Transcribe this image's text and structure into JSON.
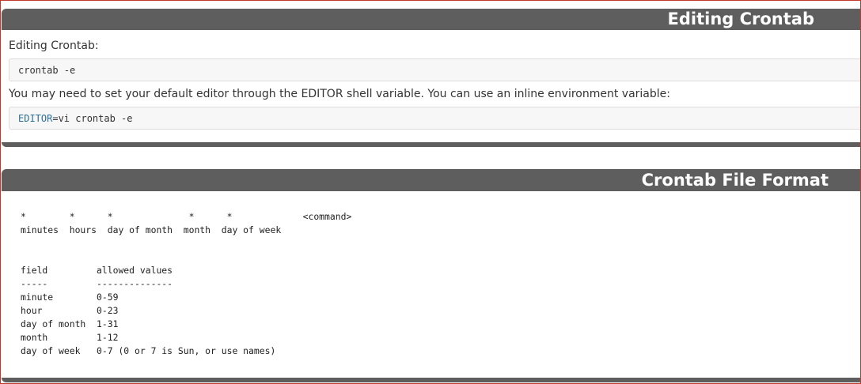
{
  "section1": {
    "title": "Editing Crontab",
    "intro": "Editing Crontab:",
    "code1": "crontab -e",
    "note": "You may need to set your default editor through the EDITOR shell variable. You can use an inline environment variable:",
    "code2_var": "EDITOR",
    "code2_rest": "=vi crontab -e"
  },
  "section2": {
    "title": "Crontab File Format",
    "format_block": "*        *      *              *      *             <command>\nminutes  hours  day of month  month  day of week",
    "fields_block": "field         allowed values\n-----         --------------\nminute        0-59\nhour          0-23\nday of month  1-31\nmonth         1-12\nday of week   0-7 (0 or 7 is Sun, or use names)"
  }
}
